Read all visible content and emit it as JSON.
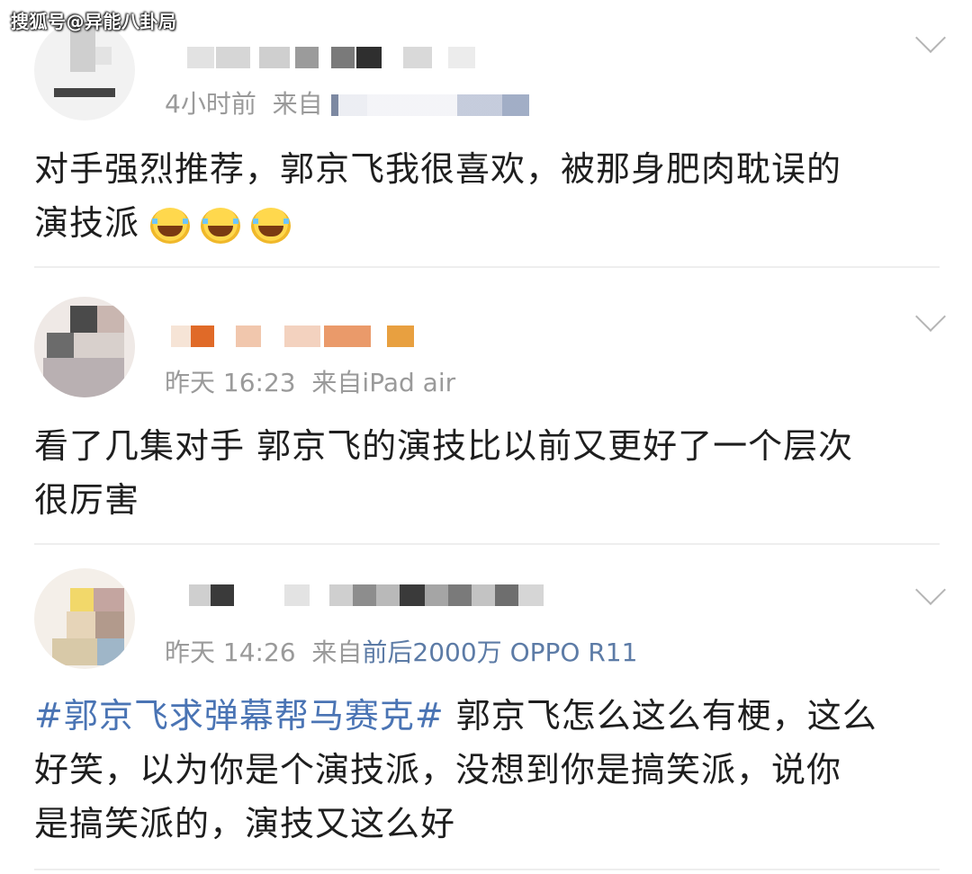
{
  "watermark": "搜狐号@异能八卦局",
  "colors": {
    "link": "#5c7ba6",
    "topic": "#4a74b4",
    "meta": "#9a9a9a"
  },
  "posts": [
    {
      "time": "4小时前",
      "source_prefix": "来自",
      "source": "",
      "text_lines": [
        "对手强烈推荐，郭京飞我很喜欢，被那身肥肉耽误的",
        "演技派"
      ],
      "emoji": "laugh-cry-icon"
    },
    {
      "time": "昨天 16:23",
      "source_prefix": "来自",
      "source": "iPad air",
      "text_lines": [
        "看了几集对手 郭京飞的演技比以前又更好了一个层次",
        "很厉害"
      ]
    },
    {
      "time": "昨天 14:26",
      "source_prefix": "来自",
      "source": "前后2000万 OPPO R11",
      "topic": "#郭京飞求弹幕帮马赛克#",
      "text_lines": [
        " 郭京飞怎么这么有梗，这么",
        "好笑，以为你是个演技派，没想到你是搞笑派，说你",
        "是搞笑派的，演技又这么好"
      ]
    }
  ]
}
